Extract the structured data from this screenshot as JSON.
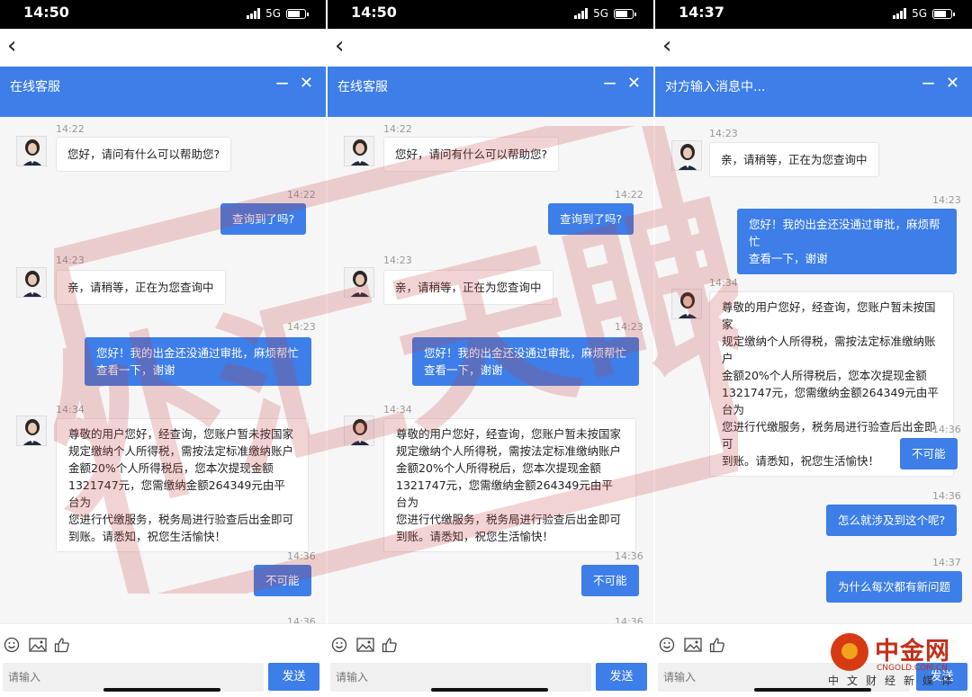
{
  "phones": [
    {
      "time": "14:50",
      "network": "5G",
      "header_title": "在线客服",
      "input_placeholder": "请输入",
      "send_label": "发送",
      "messages": [
        {
          "time": "14:22",
          "text": "您好，请问有什么可以帮助您?"
        },
        {
          "time": "14:22",
          "text": "查询到了吗?"
        },
        {
          "time": "14:23",
          "text": "亲，请稍等，正在为您查询中"
        },
        {
          "time": "14:23",
          "text_lines": [
            "您好！我的出金还没通过审批，麻烦帮忙",
            "查看一下，谢谢"
          ]
        },
        {
          "time": "14:34",
          "text_lines": [
            "尊敬的用户您好，经查询，您账户暂未按国家",
            "规定缴纳个人所得税，需按法定标准缴纳账户",
            "金额20%个人所得税后，您本次提现金额",
            "1321747元，您需缴纳金额264349元由平台为",
            "您进行代缴服务，税务局进行验查后出金即可",
            "到账。请悉知，祝您生活愉快！"
          ]
        },
        {
          "time": "14:36",
          "text": "不可能"
        },
        {
          "time": "14:36"
        }
      ]
    },
    {
      "time": "14:50",
      "network": "5G",
      "header_title": "在线客服",
      "input_placeholder": "请输入",
      "send_label": "发送",
      "messages": [
        {
          "time": "14:22",
          "text": "您好，请问有什么可以帮助您?"
        },
        {
          "time": "14:22",
          "text": "查询到了吗?"
        },
        {
          "time": "14:23",
          "text": "亲，请稍等，正在为您查询中"
        },
        {
          "time": "14:23",
          "text_lines": [
            "您好！我的出金还没通过审批，麻烦帮忙",
            "查看一下，谢谢"
          ]
        },
        {
          "time": "14:34",
          "text_lines": [
            "尊敬的用户您好，经查询，您账户暂未按国家",
            "规定缴纳个人所得税，需按法定标准缴纳账户",
            "金额20%个人所得税后，您本次提现金额",
            "1321747元，您需缴纳金额264349元由平台为",
            "您进行代缴服务，税务局进行验查后出金即可",
            "到账。请悉知，祝您生活愉快！"
          ]
        },
        {
          "time": "14:36",
          "text": "不可能"
        },
        {
          "time": "14:36"
        }
      ]
    },
    {
      "time": "14:37",
      "network": "5G",
      "header_title": "对方输入消息中...",
      "input_placeholder": "请输入",
      "send_label": "发送",
      "messages": [
        {
          "time": "14:23",
          "text": "亲，请稍等，正在为您查询中"
        },
        {
          "time": "14:23",
          "text_lines": [
            "您好！我的出金还没通过审批，麻烦帮忙",
            "查看一下，谢谢"
          ]
        },
        {
          "time": "14:34",
          "text_lines": [
            "尊敬的用户您好，经查询，您账户暂未按国家",
            "规定缴纳个人所得税，需按法定标准缴纳账户",
            "金额20%个人所得税后，您本次提现金额",
            "1321747元，您需缴纳金额264349元由平台为",
            "您进行代缴服务，税务局进行验查后出金即可",
            "到账。请悉知，祝您生活愉快！"
          ]
        },
        {
          "time": "14:36",
          "text": "不可能"
        },
        {
          "time": "14:36",
          "text": "怎么就涉及到这个呢?"
        },
        {
          "time": "14:37",
          "text": "为什么每次都有新问题"
        }
      ]
    }
  ],
  "icons": {
    "back": "chevron-left-icon",
    "minimize": "minimize-icon",
    "close": "close-icon",
    "emoji": "smile-icon",
    "image": "image-icon",
    "like": "thumbs-up-icon"
  },
  "watermark_stamp": "外汇天眼",
  "logo": {
    "name": "中金网",
    "url": "CNGOLD.COM.CN",
    "sub": "中文财经新媒体"
  },
  "colors": {
    "header": "#3d7ee8",
    "outgoing_bubble": "#3d7ee8",
    "stamp": "#c83c3c",
    "logo": "#c2301a"
  }
}
